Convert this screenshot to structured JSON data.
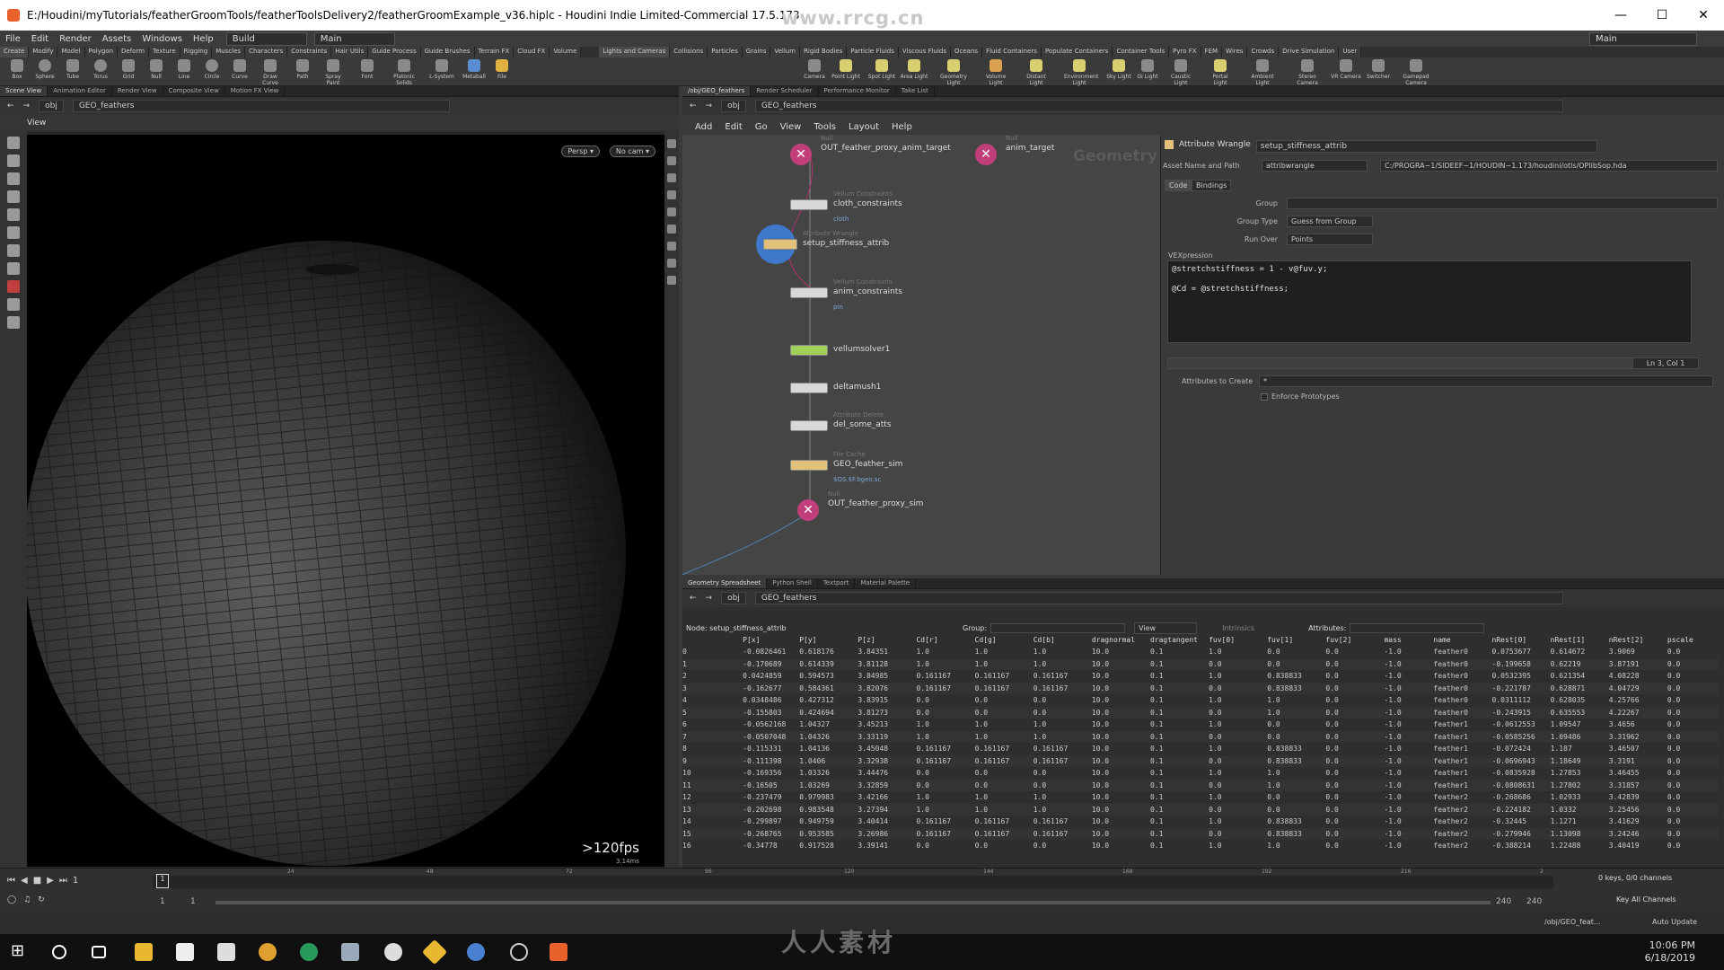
{
  "window": {
    "title": "E:/Houdini/myTutorials/featherGroomTools/featherToolsDelivery2/featherGroomExample_v36.hiplc - Houdini Indie Limited-Commercial 17.5.173",
    "watermark_top": "www.rrcg.cn"
  },
  "menu": {
    "items": [
      "File",
      "Edit",
      "Render",
      "Assets",
      "Windows",
      "Help"
    ],
    "desktop": "Build",
    "workspace": "Main",
    "right_desktop": "Main"
  },
  "shelf_tabs_left": [
    "Create",
    "Modify",
    "Model",
    "Polygon",
    "Deform",
    "Texture",
    "Rigging",
    "Muscles",
    "Characters",
    "Constraints",
    "Hair Utils",
    "Guide Process",
    "Guide Brushes",
    "Terrain FX",
    "Cloud FX",
    "Volume"
  ],
  "shelf_tabs_right": [
    "Lights and Cameras",
    "Collisions",
    "Particles",
    "Grains",
    "Vellum",
    "Rigid Bodies",
    "Particle Fluids",
    "Viscous Fluids",
    "Oceans",
    "Fluid Containers",
    "Populate Containers",
    "Container Tools",
    "Pyro FX",
    "FEM",
    "Wires",
    "Crowds",
    "Drive Simulation",
    "User"
  ],
  "shelf_tools_left": [
    "Box",
    "Sphere",
    "Tube",
    "Torus",
    "Grid",
    "Null",
    "Line",
    "Circle",
    "Curve",
    "Draw Curve",
    "Path",
    "Spray Paint",
    "Font",
    "Platonic Solids",
    "L-System",
    "Metaball",
    "File"
  ],
  "shelf_tools_right": [
    "Camera",
    "Point Light",
    "Spot Light",
    "Area Light",
    "Geometry Light",
    "Volume Light",
    "Distant Light",
    "Environment Light",
    "Sky Light",
    "GI Light",
    "Caustic Light",
    "Portal Light",
    "Ambient Light",
    "Stereo Camera",
    "VR Camera",
    "Switcher",
    "Gamepad Camera"
  ],
  "viewer": {
    "tabs": [
      "Scene View",
      "Animation Editor",
      "Render View",
      "Composite View",
      "Motion FX View"
    ],
    "path": [
      "obj",
      "GEO_feathers"
    ],
    "title": "View",
    "persp": "Persp ▾",
    "cam": "No cam ▾",
    "fps": ">120fps",
    "fps_sub": "3.14ms"
  },
  "network": {
    "tabs": [
      "/obj/GEO_feathers",
      "Render Scheduler",
      "Performance Monitor",
      "Take List"
    ],
    "path": [
      "obj",
      "GEO_feathers"
    ],
    "menu": [
      "Add",
      "Edit",
      "Go",
      "View",
      "Tools",
      "Layout",
      "Help"
    ],
    "context_label": "Geometry",
    "nodes": [
      {
        "type": "Null",
        "label": "OUT_feather_proxy_anim_target",
        "sub": ""
      },
      {
        "type": "Null",
        "label": "anim_target",
        "sub": ""
      },
      {
        "type": "Vellum Constraints",
        "label": "cloth_constraints",
        "sub": "cloth"
      },
      {
        "type": "Attribute Wrangle",
        "label": "setup_stiffness_attrib",
        "sub": ""
      },
      {
        "type": "Vellum Constraints",
        "label": "anim_constraints",
        "sub": "pin"
      },
      {
        "type": "",
        "label": "vellumsolver1",
        "sub": ""
      },
      {
        "type": "",
        "label": "deltamush1",
        "sub": ""
      },
      {
        "type": "Attribute Delete",
        "label": "del_some_atts",
        "sub": ""
      },
      {
        "type": "File Cache",
        "label": "GEO_feather_sim",
        "sub": "$OS.$F.bgeo.sc"
      },
      {
        "type": "Null",
        "label": "OUT_feather_proxy_sim",
        "sub": ""
      }
    ]
  },
  "parms": {
    "node_type": "Attribute Wrangle",
    "node_name": "setup_stiffness_attrib",
    "asset_label": "Asset Name and Path",
    "asset_name": "attribwrangle",
    "asset_path": "C:/PROGRA~1/SIDEEF~1/HOUDIN~1.173/houdini/otls/OPlibSop.hda",
    "tabs": [
      "Code",
      "Bindings"
    ],
    "group_label": "Group",
    "group_value": "",
    "group_type_label": "Group Type",
    "group_type": "Guess from Group",
    "run_over_label": "Run Over",
    "run_over": "Points",
    "vex_label": "VEXpression",
    "vex_line1": "@stretchstiffness = 1 - v@fuv.y;",
    "vex_line2": "@Cd = @stretchstiffness;",
    "cursor_pos": "Ln 3, Col 1",
    "attrs_label": "Attributes to Create",
    "attrs_value": "*",
    "enforce_label": "Enforce Prototypes"
  },
  "spreadsheet": {
    "tabs": [
      "Geometry Spreadsheet",
      "Python Shell",
      "Textport",
      "Material Palette"
    ],
    "path": [
      "obj",
      "GEO_feathers"
    ],
    "node_label": "Node: setup_stiffness_attrib",
    "group_label": "Group:",
    "view_label": "View",
    "intrinsics_label": "Intrinsics",
    "attributes_label": "Attributes:",
    "columns": [
      "",
      "P[x]",
      "P[y]",
      "P[z]",
      "Cd[r]",
      "Cd[g]",
      "Cd[b]",
      "dragnormal",
      "dragtangent",
      "fuv[0]",
      "fuv[1]",
      "fuv[2]",
      "mass",
      "name",
      "nRest[0]",
      "nRest[1]",
      "nRest[2]",
      "pscale"
    ],
    "rows": [
      [
        "0",
        "-0.0826461",
        "0.618176",
        "3.84351",
        "1.0",
        "1.0",
        "1.0",
        "10.0",
        "0.1",
        "1.0",
        "0.0",
        "0.0",
        "-1.0",
        "feather0",
        "0.0753677",
        "0.614672",
        "3.9069",
        "0.0"
      ],
      [
        "1",
        "-0.170689",
        "0.614339",
        "3.81128",
        "1.0",
        "1.0",
        "1.0",
        "10.0",
        "0.1",
        "0.0",
        "0.0",
        "0.0",
        "-1.0",
        "feather0",
        "-0.199658",
        "0.62219",
        "3.87191",
        "0.0"
      ],
      [
        "2",
        "0.0424859",
        "0.594573",
        "3.84985",
        "0.161167",
        "0.161167",
        "0.161167",
        "10.0",
        "0.1",
        "1.0",
        "0.838833",
        "0.0",
        "-1.0",
        "feather0",
        "0.0532395",
        "0.621354",
        "4.08228",
        "0.0"
      ],
      [
        "3",
        "-0.162677",
        "0.584361",
        "3.82076",
        "0.161167",
        "0.161167",
        "0.161167",
        "10.0",
        "0.1",
        "0.0",
        "0.838833",
        "0.0",
        "-1.0",
        "feather0",
        "-0.221787",
        "0.628871",
        "4.04729",
        "0.0"
      ],
      [
        "4",
        "0.0348486",
        "0.427312",
        "3.83915",
        "0.0",
        "0.0",
        "0.0",
        "10.0",
        "0.1",
        "1.0",
        "1.0",
        "0.0",
        "-1.0",
        "feather0",
        "0.0311112",
        "0.628035",
        "4.25766",
        "0.0"
      ],
      [
        "5",
        "-0.155803",
        "0.424694",
        "3.81273",
        "0.0",
        "0.0",
        "0.0",
        "10.0",
        "0.1",
        "0.0",
        "1.0",
        "0.0",
        "-1.0",
        "feather0",
        "-0.243915",
        "0.635553",
        "4.22267",
        "0.0"
      ],
      [
        "6",
        "-0.0562168",
        "1.04327",
        "3.45213",
        "1.0",
        "1.0",
        "1.0",
        "10.0",
        "0.1",
        "1.0",
        "0.0",
        "0.0",
        "-1.0",
        "feather1",
        "-0.0612553",
        "1.09547",
        "3.4656",
        "0.0"
      ],
      [
        "7",
        "-0.0507048",
        "1.04326",
        "3.33119",
        "1.0",
        "1.0",
        "1.0",
        "10.0",
        "0.1",
        "0.0",
        "0.0",
        "0.0",
        "-1.0",
        "feather1",
        "-0.0585256",
        "1.09486",
        "3.31962",
        "0.0"
      ],
      [
        "8",
        "-0.115331",
        "1.04136",
        "3.45048",
        "0.161167",
        "0.161167",
        "0.161167",
        "10.0",
        "0.1",
        "1.0",
        "0.838833",
        "0.0",
        "-1.0",
        "feather1",
        "-0.072424",
        "1.187",
        "3.46507",
        "0.0"
      ],
      [
        "9",
        "-0.111398",
        "1.0406",
        "3.32938",
        "0.161167",
        "0.161167",
        "0.161167",
        "10.0",
        "0.1",
        "0.0",
        "0.838833",
        "0.0",
        "-1.0",
        "feather1",
        "-0.0696943",
        "1.18649",
        "3.3191",
        "0.0"
      ],
      [
        "10",
        "-0.169356",
        "1.03326",
        "3.44476",
        "0.0",
        "0.0",
        "0.0",
        "10.0",
        "0.1",
        "1.0",
        "1.0",
        "0.0",
        "-1.0",
        "feather1",
        "-0.0835928",
        "1.27853",
        "3.46455",
        "0.0"
      ],
      [
        "11",
        "-0.16505",
        "1.03269",
        "3.32859",
        "0.0",
        "0.0",
        "0.0",
        "10.0",
        "0.1",
        "0.0",
        "1.0",
        "0.0",
        "-1.0",
        "feather1",
        "-0.0808631",
        "1.27802",
        "3.31857",
        "0.0"
      ],
      [
        "12",
        "-0.237479",
        "0.979983",
        "3.42166",
        "1.0",
        "1.0",
        "1.0",
        "10.0",
        "0.1",
        "1.0",
        "0.0",
        "0.0",
        "-1.0",
        "feather2",
        "-0.268686",
        "1.02933",
        "3.42839",
        "0.0"
      ],
      [
        "13",
        "-0.202698",
        "0.983548",
        "3.27394",
        "1.0",
        "1.0",
        "1.0",
        "10.0",
        "0.1",
        "0.0",
        "0.0",
        "0.0",
        "-1.0",
        "feather2",
        "-0.224182",
        "1.0332",
        "3.25456",
        "0.0"
      ],
      [
        "14",
        "-0.299897",
        "0.949759",
        "3.40414",
        "0.161167",
        "0.161167",
        "0.161167",
        "10.0",
        "0.1",
        "1.0",
        "0.838833",
        "0.0",
        "-1.0",
        "feather2",
        "-0.32445",
        "1.1271",
        "3.41629",
        "0.0"
      ],
      [
        "15",
        "-0.268765",
        "0.953585",
        "3.26986",
        "0.161167",
        "0.161167",
        "0.161167",
        "10.0",
        "0.1",
        "0.0",
        "0.838833",
        "0.0",
        "-1.0",
        "feather2",
        "-0.279946",
        "1.13098",
        "3.24246",
        "0.0"
      ],
      [
        "16",
        "-0.34778",
        "0.917528",
        "3.39141",
        "0.0",
        "0.0",
        "0.0",
        "10.0",
        "0.1",
        "1.0",
        "1.0",
        "0.0",
        "-1.0",
        "feather2",
        "-0.388214",
        "1.22488",
        "3.40419",
        "0.0"
      ]
    ]
  },
  "timeline": {
    "frame": "1",
    "start": "1",
    "start2": "1",
    "ticks": [
      "24",
      "48",
      "72",
      "96",
      "120",
      "144",
      "168",
      "192",
      "216",
      "2"
    ],
    "end1": "240",
    "end2": "240",
    "keys": "0 keys, 0/0 channels",
    "key_all": "Key All Channels",
    "path": "/obj/GEO_feat...",
    "update": "Auto Update"
  },
  "taskbar": {
    "time": "10:06 PM",
    "date": "6/18/2019",
    "watermark": "人人素材"
  }
}
